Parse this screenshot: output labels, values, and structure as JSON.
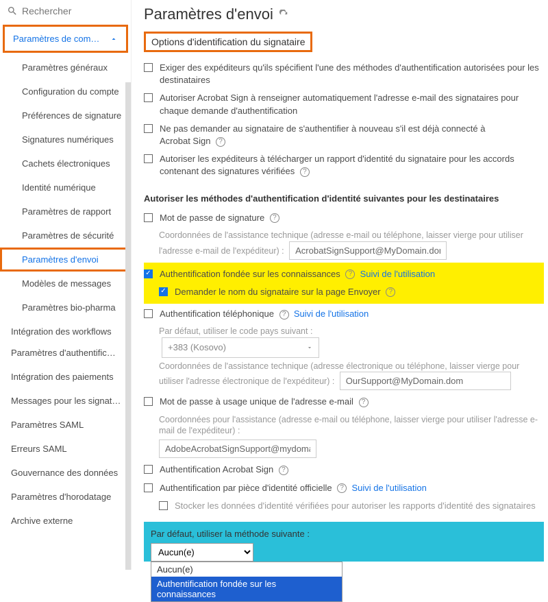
{
  "search": {
    "placeholder": "Rechercher"
  },
  "sidebar": {
    "header": "Paramètres de com…",
    "items": [
      "Paramètres généraux",
      "Configuration du compte",
      "Préférences de signature",
      "Signatures numériques",
      "Cachets électroniques",
      "Identité numérique",
      "Paramètres de rapport",
      "Paramètres de sécurité",
      "Paramètres d'envoi",
      "Modèles de messages",
      "Paramètres bio-pharma"
    ],
    "section2": "Intégration des workflows",
    "items2": [
      "Paramètres d'authentific…",
      "Intégration des paiements",
      "Messages pour les signat…",
      "Paramètres SAML",
      "Erreurs SAML",
      "Gouvernance des données",
      "Paramètres d'horodatage",
      "Archive externe"
    ]
  },
  "page": {
    "title": "Paramètres d'envoi",
    "section": "Options d'identification du signataire"
  },
  "opts": {
    "o1": "Exiger des expéditeurs qu'ils spécifient l'une des méthodes d'authentification autorisées pour les destinataires",
    "o2": "Autoriser Acrobat Sign à renseigner automatiquement l'adresse e-mail des signataires pour chaque demande d'authentification",
    "o3a": "Ne pas demander au signataire de s'authentifier à nouveau s'il est déjà connecté à",
    "o3b": "Acrobat Sign",
    "o4": "Autoriser les expéditeurs à télécharger un rapport d'identité du signataire pour les accords contenant des signatures vérifiées"
  },
  "auth": {
    "heading": "Autoriser les méthodes d'authentification d'identité suivantes pour les destinataires",
    "pw": "Mot de passe de signature",
    "pw_hint": "Coordonnées de l'assistance technique (adresse e-mail ou téléphone, laisser vierge pour utiliser l'adresse e-mail de l'expéditeur) :",
    "pw_val": "AcrobatSignSupport@MyDomain.dom",
    "kba": "Authentification fondée sur les connaissances",
    "kba_link": "Suivi de l'utilisation",
    "kba_sub": "Demander le nom du signataire sur la page Envoyer",
    "phone": "Authentification téléphonique",
    "phone_link": "Suivi de l'utilisation",
    "phone_hint": "Par défaut, utiliser le code pays suivant :",
    "phone_code": "+383 (Kosovo)",
    "phone_support_hint": "Coordonnées de l'assistance technique (adresse électronique ou téléphone, laisser vierge pour utiliser l'adresse électronique de l'expéditeur) :",
    "phone_support_val": "OurSupport@MyDomain.dom",
    "otp": "Mot de passe à usage unique de l'adresse e-mail",
    "otp_hint": "Coordonnées pour l'assistance (adresse e-mail ou téléphone, laisser vierge pour utiliser l'adresse e-mail de l'expéditeur) :",
    "otp_val": "AdobeAcrobatSignSupport@mydomain.dom",
    "as": "Authentification Acrobat Sign",
    "gov": "Authentification par pièce d'identité officielle",
    "gov_link": "Suivi de l'utilisation",
    "gov_sub": "Stocker les données d'identité vérifiées pour autoriser les rapports d'identité des signataires"
  },
  "default": {
    "label": "Par défaut, utiliser la méthode suivante :",
    "selected": "Aucun(e)",
    "options": [
      "Aucun(e)",
      "Authentification fondée sur les connaissances"
    ]
  }
}
